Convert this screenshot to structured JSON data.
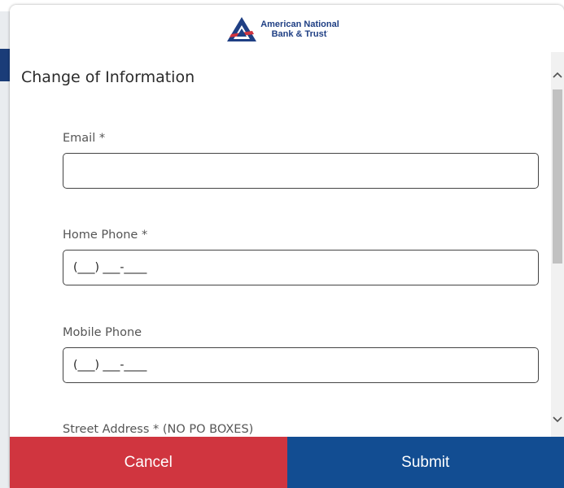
{
  "brand": {
    "name_line1": "American National",
    "name_line2": "Bank & Trust",
    "trademark": "˙",
    "colors": {
      "logo_blue": "#1f3f84",
      "logo_red": "#d0353f"
    }
  },
  "form": {
    "title": "Change of Information",
    "fields": [
      {
        "label": "Email *",
        "value": "",
        "placeholder": ""
      },
      {
        "label": "Home Phone *",
        "value": "(___) ___-____",
        "placeholder": ""
      },
      {
        "label": "Mobile Phone",
        "value": "(___) ___-____",
        "placeholder": ""
      },
      {
        "label": "Street Address * (NO PO BOXES)"
      }
    ]
  },
  "scrollbar": {
    "up_icon": "chevron-up-icon",
    "down_icon": "chevron-down-icon"
  },
  "footer": {
    "cancel_label": "Cancel",
    "submit_label": "Submit",
    "colors": {
      "cancel": "#d0353f",
      "submit": "#124d92"
    }
  }
}
